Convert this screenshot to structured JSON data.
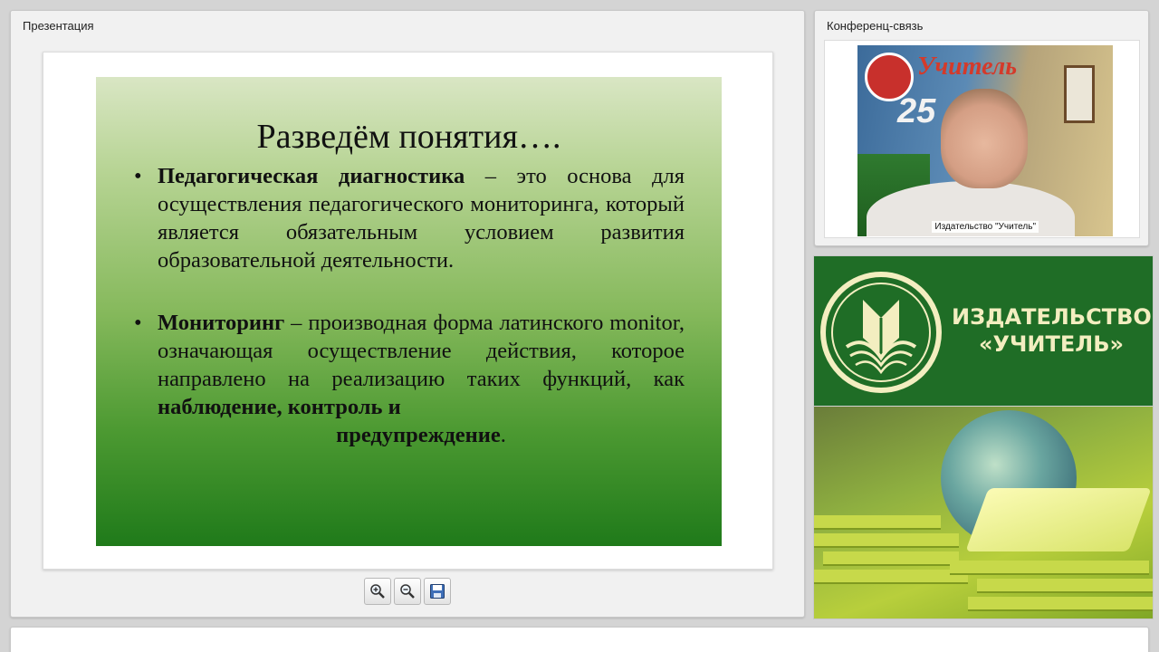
{
  "presentation": {
    "panel_title": "Презентация",
    "slide": {
      "title": "Разведём понятия….",
      "bullets": [
        {
          "bold_term": "Педагогическая диагностика",
          "text": " – это основа для осуществления педагогического мониторинга, который является обязательным условием развития образовательной деятельности."
        },
        {
          "bold_term": "Мониторинг",
          "text": " – производная форма латинского monitor, означающая осуществление действия, которое направлено на реализацию таких функций, как ",
          "bold_tail_1": "наблюдение, контроль и",
          "bold_tail_2": "предупреждение",
          "end": "."
        }
      ],
      "bullet_char": "•"
    },
    "toolbar": {
      "zoom_in_icon": "zoom-in-icon",
      "zoom_out_icon": "zoom-out-icon",
      "save_icon": "save-icon"
    }
  },
  "conference": {
    "panel_title": "Конференц-связь",
    "video": {
      "participant_label": "Издательство \"Учитель\"",
      "background_brand": "Учитель",
      "background_badge": "25"
    }
  },
  "banner": {
    "line1": "ИЗДАТЕЛЬСТВО",
    "line2": "«УЧИТЕЛЬ»"
  },
  "colors": {
    "banner_green": "#1f6d26",
    "banner_text": "#f3eec0",
    "slide_top": "#d9e6c4",
    "slide_bottom": "#1f7a1a"
  }
}
